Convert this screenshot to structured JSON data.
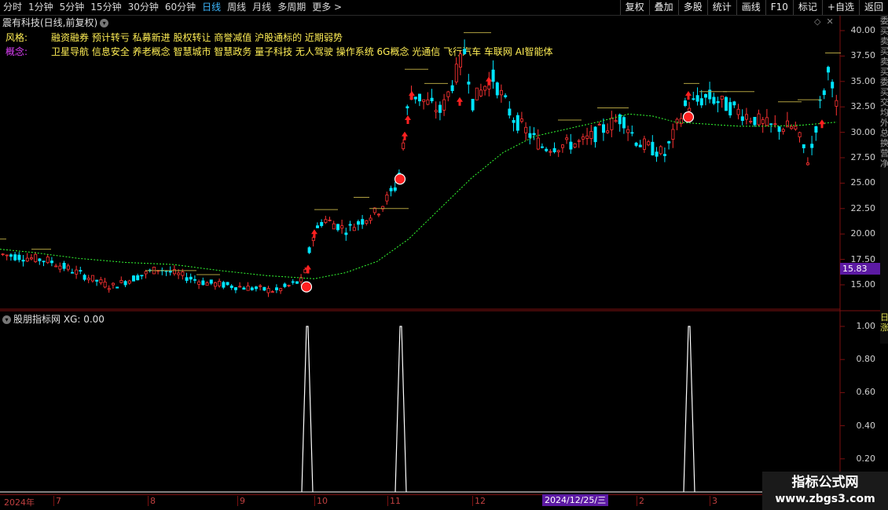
{
  "toolbar": {
    "periods": [
      "分时",
      "1分钟",
      "5分钟",
      "15分钟",
      "30分钟",
      "60分钟",
      "日线",
      "周线",
      "月线",
      "多周期",
      "更多 >"
    ],
    "active_period": "日线",
    "buttons": [
      "复权",
      "叠加",
      "多股",
      "统计",
      "画线",
      "F10",
      "标记",
      "+自选",
      "返回"
    ]
  },
  "stock": {
    "title": "震有科技(日线,前复权)"
  },
  "info": {
    "style_label": "风格:",
    "style_value": "融资融券 预计转亏 私募新进 股权转让 商誉减值 沪股通标的 近期弱势",
    "concept_label": "概念:",
    "concept_value": "卫星导航 信息安全 养老概念 智慧城市 智慧政务 量子科技 无人驾驶 操作系统 6G概念 光通信 飞行汽车 车联网 AI智能体"
  },
  "price_axis": [
    "40.00",
    "37.50",
    "35.00",
    "32.50",
    "30.00",
    "27.50",
    "25.00",
    "22.50",
    "20.00",
    "17.50",
    "15.00"
  ],
  "current_price": "15.83",
  "indicator": {
    "title": "股朋指标网",
    "xg_text": "XG: 0.00",
    "axis": [
      "1.00",
      "0.80",
      "0.60",
      "0.40",
      "0.20"
    ]
  },
  "date_axis": [
    "2024年",
    "7",
    "8",
    "9",
    "10",
    "11",
    "12",
    "2",
    "3"
  ],
  "date_highlight": "2024/12/25/三",
  "sidebar_text": "委买卖买卖买委买交均外总换营净",
  "sidebar2_text": "日涨",
  "watermark": {
    "line1": "指标公式网",
    "line2": "www.zbgs3.com"
  },
  "colors": {
    "up": "#ff3232",
    "down": "#00e5ff",
    "ma": "#33ff33",
    "accent": "#3db8ff",
    "signal": "#ffffff"
  },
  "chart_data": {
    "type": "candlestick",
    "ylim": [
      13,
      41
    ],
    "ma_points": [
      [
        0,
        18.5
      ],
      [
        40,
        18.2
      ],
      [
        100,
        17.6
      ],
      [
        160,
        17.2
      ],
      [
        220,
        17.0
      ],
      [
        280,
        16.4
      ],
      [
        340,
        15.9
      ],
      [
        400,
        15.6
      ],
      [
        440,
        16.2
      ],
      [
        480,
        17.3
      ],
      [
        520,
        19.5
      ],
      [
        560,
        22.5
      ],
      [
        600,
        25.5
      ],
      [
        640,
        28.0
      ],
      [
        680,
        29.6
      ],
      [
        720,
        30.3
      ],
      [
        760,
        31.0
      ],
      [
        800,
        31.8
      ],
      [
        830,
        31.6
      ],
      [
        860,
        31.0
      ],
      [
        900,
        30.8
      ],
      [
        940,
        30.6
      ],
      [
        980,
        30.6
      ],
      [
        1020,
        30.7
      ],
      [
        1065,
        31.0
      ]
    ],
    "signals_x": [
      390,
      509,
      876
    ],
    "xg_series": {
      "name": "XG",
      "signal_positions": [
        390,
        509,
        876
      ],
      "value": 0
    }
  }
}
